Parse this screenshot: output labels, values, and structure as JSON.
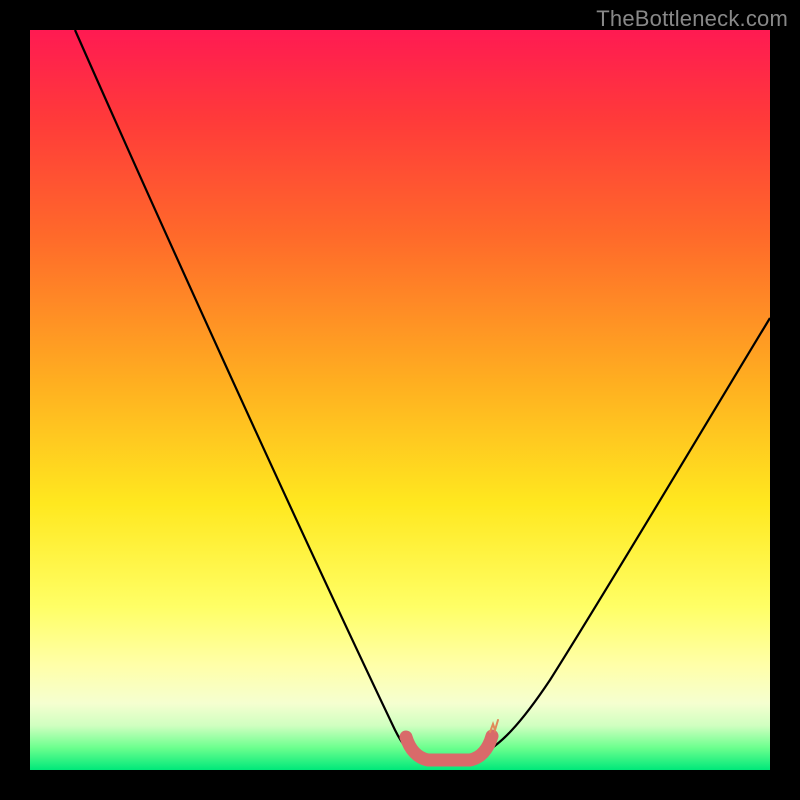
{
  "watermark": "TheBottleneck.com",
  "chart_data": {
    "type": "line",
    "title": "",
    "xlabel": "",
    "ylabel": "",
    "xlim": [
      0,
      100
    ],
    "ylim": [
      0,
      100
    ],
    "series": [
      {
        "name": "bottleneck-curve",
        "x": [
          0,
          5,
          10,
          15,
          20,
          25,
          30,
          35,
          40,
          45,
          48,
          50,
          52,
          54,
          56,
          58,
          60,
          62,
          65,
          70,
          75,
          80,
          85,
          90,
          95,
          100
        ],
        "y": [
          100,
          92,
          84,
          76,
          68,
          60,
          51,
          42,
          33,
          22,
          13,
          6,
          2,
          0,
          0,
          0,
          1,
          3,
          7,
          14,
          22,
          30,
          38,
          46,
          54,
          62
        ]
      },
      {
        "name": "optimal-band",
        "x": [
          51,
          53,
          55,
          57,
          59,
          61
        ],
        "y": [
          3,
          1,
          0,
          0,
          1,
          3
        ]
      }
    ],
    "annotations": []
  },
  "colors": {
    "curve": "#000000",
    "optimal_band": "#d96a6a",
    "background_top": "#ff1a52",
    "background_bottom": "#00e87a"
  }
}
